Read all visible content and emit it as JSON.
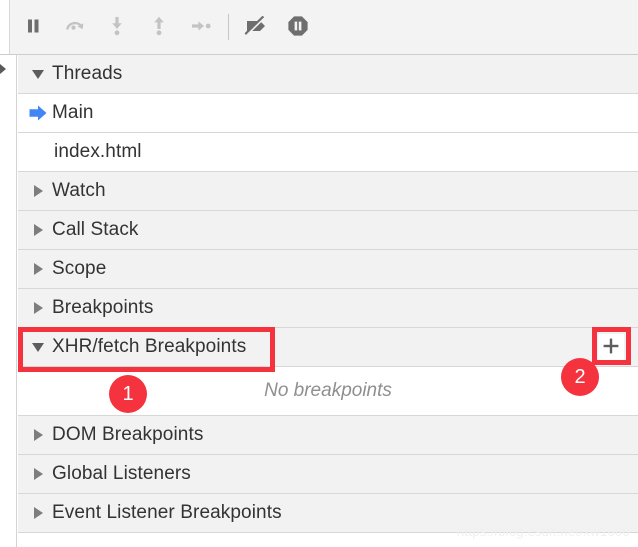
{
  "toolbar": {
    "buttons": [
      {
        "name": "resume-button",
        "icon": "pause-icon",
        "title": "Pause script execution"
      },
      {
        "name": "step-over-button",
        "icon": "step-over-icon",
        "title": "Step over next function call"
      },
      {
        "name": "step-into-button",
        "icon": "step-into-icon",
        "title": "Step into next function call"
      },
      {
        "name": "step-out-button",
        "icon": "step-out-icon",
        "title": "Step out of current function"
      },
      {
        "name": "step-button",
        "icon": "step-icon",
        "title": "Step"
      },
      {
        "name": "deactivate-breakpoints-button",
        "icon": "deactivate-breakpoints-icon",
        "title": "Deactivate breakpoints"
      },
      {
        "name": "pause-on-exceptions-button",
        "icon": "pause-on-exceptions-icon",
        "title": "Pause on exceptions"
      }
    ]
  },
  "tree": {
    "threads": {
      "label": "Threads",
      "expanded": true,
      "items": [
        {
          "label": "Main",
          "icon": "selected-thread-arrow-icon"
        },
        {
          "label": "index.html",
          "icon": ""
        }
      ]
    },
    "sections": [
      {
        "label": "Watch",
        "expanded": false
      },
      {
        "label": "Call Stack",
        "expanded": false
      },
      {
        "label": "Scope",
        "expanded": false
      },
      {
        "label": "Breakpoints",
        "expanded": false
      }
    ],
    "xhr": {
      "label": "XHR/fetch Breakpoints",
      "expanded": true,
      "empty_text": "No breakpoints",
      "add_button_label": "+"
    },
    "bottom_sections": [
      {
        "label": "DOM Breakpoints",
        "expanded": false
      },
      {
        "label": "Global Listeners",
        "expanded": false
      },
      {
        "label": "Event Listener Breakpoints",
        "expanded": false
      }
    ]
  },
  "annotations": {
    "accent_color": "#f5333f",
    "badges": [
      {
        "name": "annotation-badge-1",
        "text": "1"
      },
      {
        "name": "annotation-badge-2",
        "text": "2"
      }
    ]
  },
  "watermark": {
    "text": "https://blog.csdn.net/xw1680"
  }
}
